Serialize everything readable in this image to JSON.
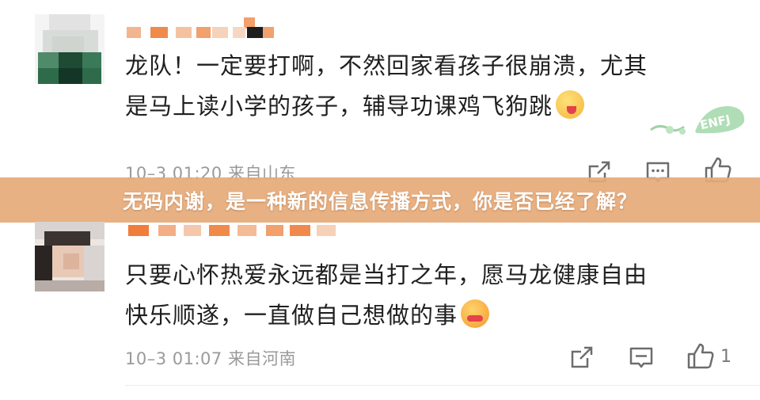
{
  "banner": {
    "text": "无码内谢，是一种新的信息传播方式，你是否已经了解？",
    "color": "#e6aa78"
  },
  "comments": [
    {
      "line1": "龙队！一定要打啊，不然回家看孩子很崩溃，尤其",
      "line2": "是马上读小学的孩子，辅导功课鸡飞狗跳",
      "emoji": "yum-face-icon",
      "meta": "10–3 01:20 来自山东",
      "like_count": "",
      "badge_text": "ENFJ"
    },
    {
      "line1": "只要心怀热爱永远都是当打之年，愿马龙健康自由",
      "line2": "快乐顺遂，一直做自己想做的事",
      "emoji": "heart-eyes-face-icon",
      "meta": "10–3 01:07 来自河南",
      "like_count": "1"
    }
  ],
  "icons": {
    "share": "share-icon",
    "comment": "comment-icon",
    "like": "thumbs-up-icon"
  }
}
